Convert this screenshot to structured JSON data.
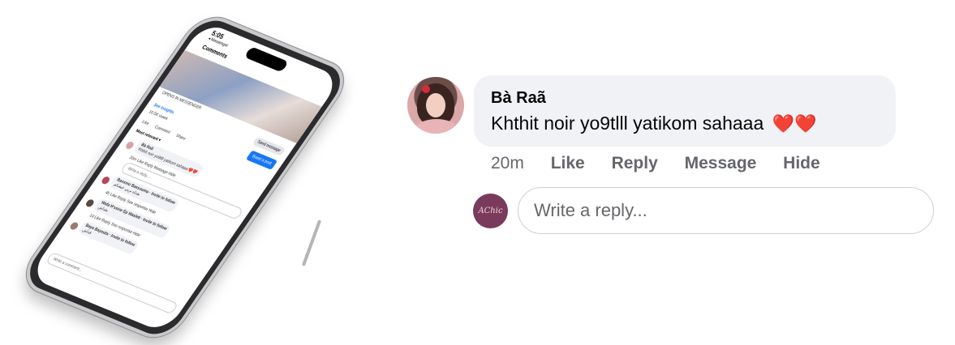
{
  "phone": {
    "time": "5:05",
    "back_app": "◂ Messenger",
    "header": "Comments",
    "opens_in": "OPENS IN MESSENGER",
    "send_message": "Send message",
    "see_insights": "See insights",
    "views": "10.5K views",
    "boost": "Boost a post",
    "like": "Like",
    "comment": "Comment",
    "share": "Share",
    "sort": "Most relevant ▾",
    "c1_name": "Bà Raã",
    "c1_text": "Khthit noir yo9tlll yatikom sahaaa ❤️❤️",
    "c1_meta": "20m  Like  Reply  Message  Hide",
    "c1_reply_ph": "Write a reply...",
    "c2_name": "Bassmo Bassouma · Invite to follow",
    "c2_text": "بقداه بربي عيشكم",
    "c2_meta": "4h  Like  Reply  See response  Hide",
    "c3_name": "Wafa H'ssine Ep Wasleti · Invite to follow",
    "c3_text": "بقداش",
    "c3_meta": "1d  Like  Reply  See response  Hide",
    "c4_name": "Baya Bayouta · Invite to follow",
    "c4_text": "قداش",
    "comment_ph": "Write a comment..."
  },
  "comment": {
    "author": "Bà Raã",
    "text": "Khthit noir yo9tlll yatikom sahaaa",
    "hearts": "❤️❤️",
    "time": "20m",
    "actions": {
      "like": "Like",
      "reply": "Reply",
      "message": "Message",
      "hide": "Hide"
    },
    "reply_placeholder": "Write a reply...",
    "reply_avatar_text": "AChic"
  }
}
